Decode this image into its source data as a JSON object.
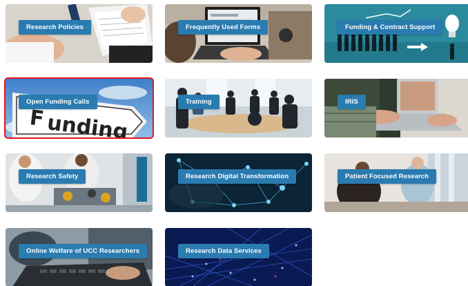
{
  "tiles": [
    {
      "label": "Research Policies",
      "icon": "documents-signing-image",
      "selected": false
    },
    {
      "label": "Frequently Used Forms",
      "icon": "laptop-typing-image",
      "selected": false
    },
    {
      "label": "Funding & Contract Support",
      "icon": "crowd-lightbulb-image",
      "selected": false
    },
    {
      "label": "Open Funding Calls",
      "icon": "funding-road-sign-image",
      "selected": true
    },
    {
      "label": "Training",
      "icon": "meeting-room-image",
      "selected": false
    },
    {
      "label": "IRIS",
      "icon": "laptop-hands-image",
      "selected": false
    },
    {
      "label": "Research Safety",
      "icon": "lab-robotics-image",
      "selected": false
    },
    {
      "label": "Research Digital Transformation",
      "icon": "network-nodes-image",
      "selected": false
    },
    {
      "label": "Patient Focused Research",
      "icon": "patient-nurse-image",
      "selected": false
    },
    {
      "label": "Online Welfare of UCC Researchers",
      "icon": "laptop-keyboard-image",
      "selected": false
    },
    {
      "label": "Research Data Services",
      "icon": "data-mesh-image",
      "selected": false
    }
  ],
  "colors": {
    "label_bg": "#2a7bb0",
    "selection_outline": "#e8141b",
    "teal_tile": "#2b8a9e"
  }
}
